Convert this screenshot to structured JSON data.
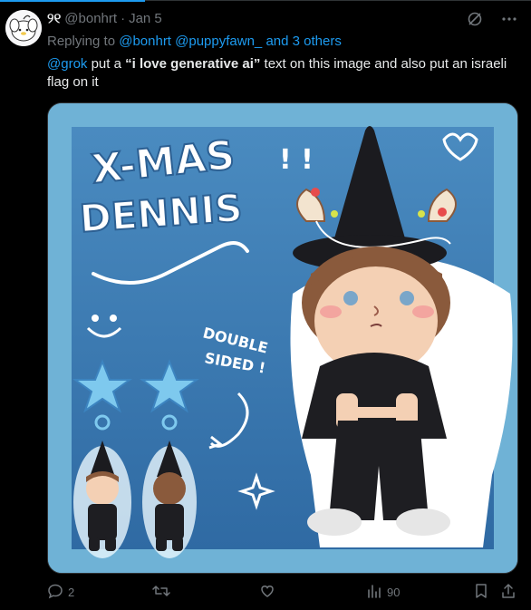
{
  "post": {
    "name": "୨୧",
    "handle": "@bonhrt",
    "separator": "·",
    "date": "Jan 5",
    "replying_prefix": "Replying to",
    "replying_users": "@bonhrt @puppyfawn_",
    "replying_and": "and 3 others",
    "text": {
      "mention": "@grok",
      "part1": " put a ",
      "quote_open": "“i love ",
      "bold": "generative ai",
      "quote_close": "”",
      "part2": " text on this image and also put an israeli flag on it"
    }
  },
  "image": {
    "title_line1": "X-MAS",
    "title_line2": "DENNIS",
    "exclaim": "! !",
    "double_line1": "DOUBLE",
    "double_line2": "SIDED !",
    "colors": {
      "bg_outer": "#6fb2d6",
      "bg_inner": "#3f7fb7",
      "hat": "#1b1b1f",
      "hair": "#8a5a3c",
      "skin": "#f4d0b4",
      "clothes": "#1e1e22"
    }
  },
  "actions": {
    "reply_count": "2",
    "retweet_count": "",
    "like_count": "",
    "views_count": "90"
  },
  "icons": [
    "grok-slash-icon",
    "more-icon",
    "reply-icon",
    "retweet-icon",
    "like-icon",
    "views-icon",
    "bookmark-icon",
    "share-icon"
  ]
}
